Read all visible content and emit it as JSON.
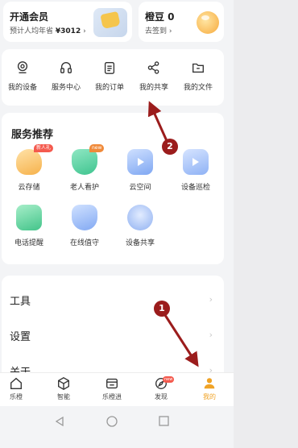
{
  "vip_card": {
    "title": "开通会员",
    "subtitle_prefix": "预计人均年省",
    "subtitle_amount": "¥3012",
    "chevron": "›"
  },
  "beans_card": {
    "title": "橙豆 0",
    "subtitle": "去签到",
    "chevron": "›"
  },
  "quick_actions": [
    {
      "label": "我的设备",
      "icon": "camera-icon"
    },
    {
      "label": "服务中心",
      "icon": "headset-icon"
    },
    {
      "label": "我的订单",
      "icon": "clipboard-icon"
    },
    {
      "label": "我的共享",
      "icon": "share-icon"
    },
    {
      "label": "我的文件",
      "icon": "folder-icon"
    }
  ],
  "services": {
    "title": "服务推荐",
    "items": [
      {
        "label": "云存储",
        "badge": "新人礼",
        "icon": "cloud-storage-icon"
      },
      {
        "label": "老人看护",
        "badge": "new",
        "icon": "elder-care-icon"
      },
      {
        "label": "云空间",
        "badge": "",
        "icon": "cloud-space-icon"
      },
      {
        "label": "设备巡检",
        "badge": "",
        "icon": "device-inspection-icon"
      },
      {
        "label": "电话提醒",
        "badge": "",
        "icon": "phone-reminder-icon"
      },
      {
        "label": "在线值守",
        "badge": "",
        "icon": "online-guard-icon"
      },
      {
        "label": "设备共享",
        "badge": "",
        "icon": "device-share-icon"
      }
    ]
  },
  "settings": [
    {
      "label": "工具",
      "chevron": "›"
    },
    {
      "label": "设置",
      "chevron": "›"
    },
    {
      "label": "关于",
      "chevron": "›"
    }
  ],
  "tabs": [
    {
      "label": "乐橙",
      "icon": "home-icon",
      "active": false
    },
    {
      "label": "智能",
      "icon": "cube-icon",
      "active": false
    },
    {
      "label": "乐橙逍",
      "icon": "store-icon",
      "active": false
    },
    {
      "label": "发现",
      "icon": "discover-icon",
      "active": false,
      "badge": "new"
    },
    {
      "label": "我的",
      "icon": "profile-icon",
      "active": true
    }
  ],
  "annotations": [
    {
      "number": "1"
    },
    {
      "number": "2"
    }
  ],
  "colors": {
    "accent": "#f0a326",
    "annotation": "#9b1c1c",
    "badge": "#f45a4e"
  }
}
